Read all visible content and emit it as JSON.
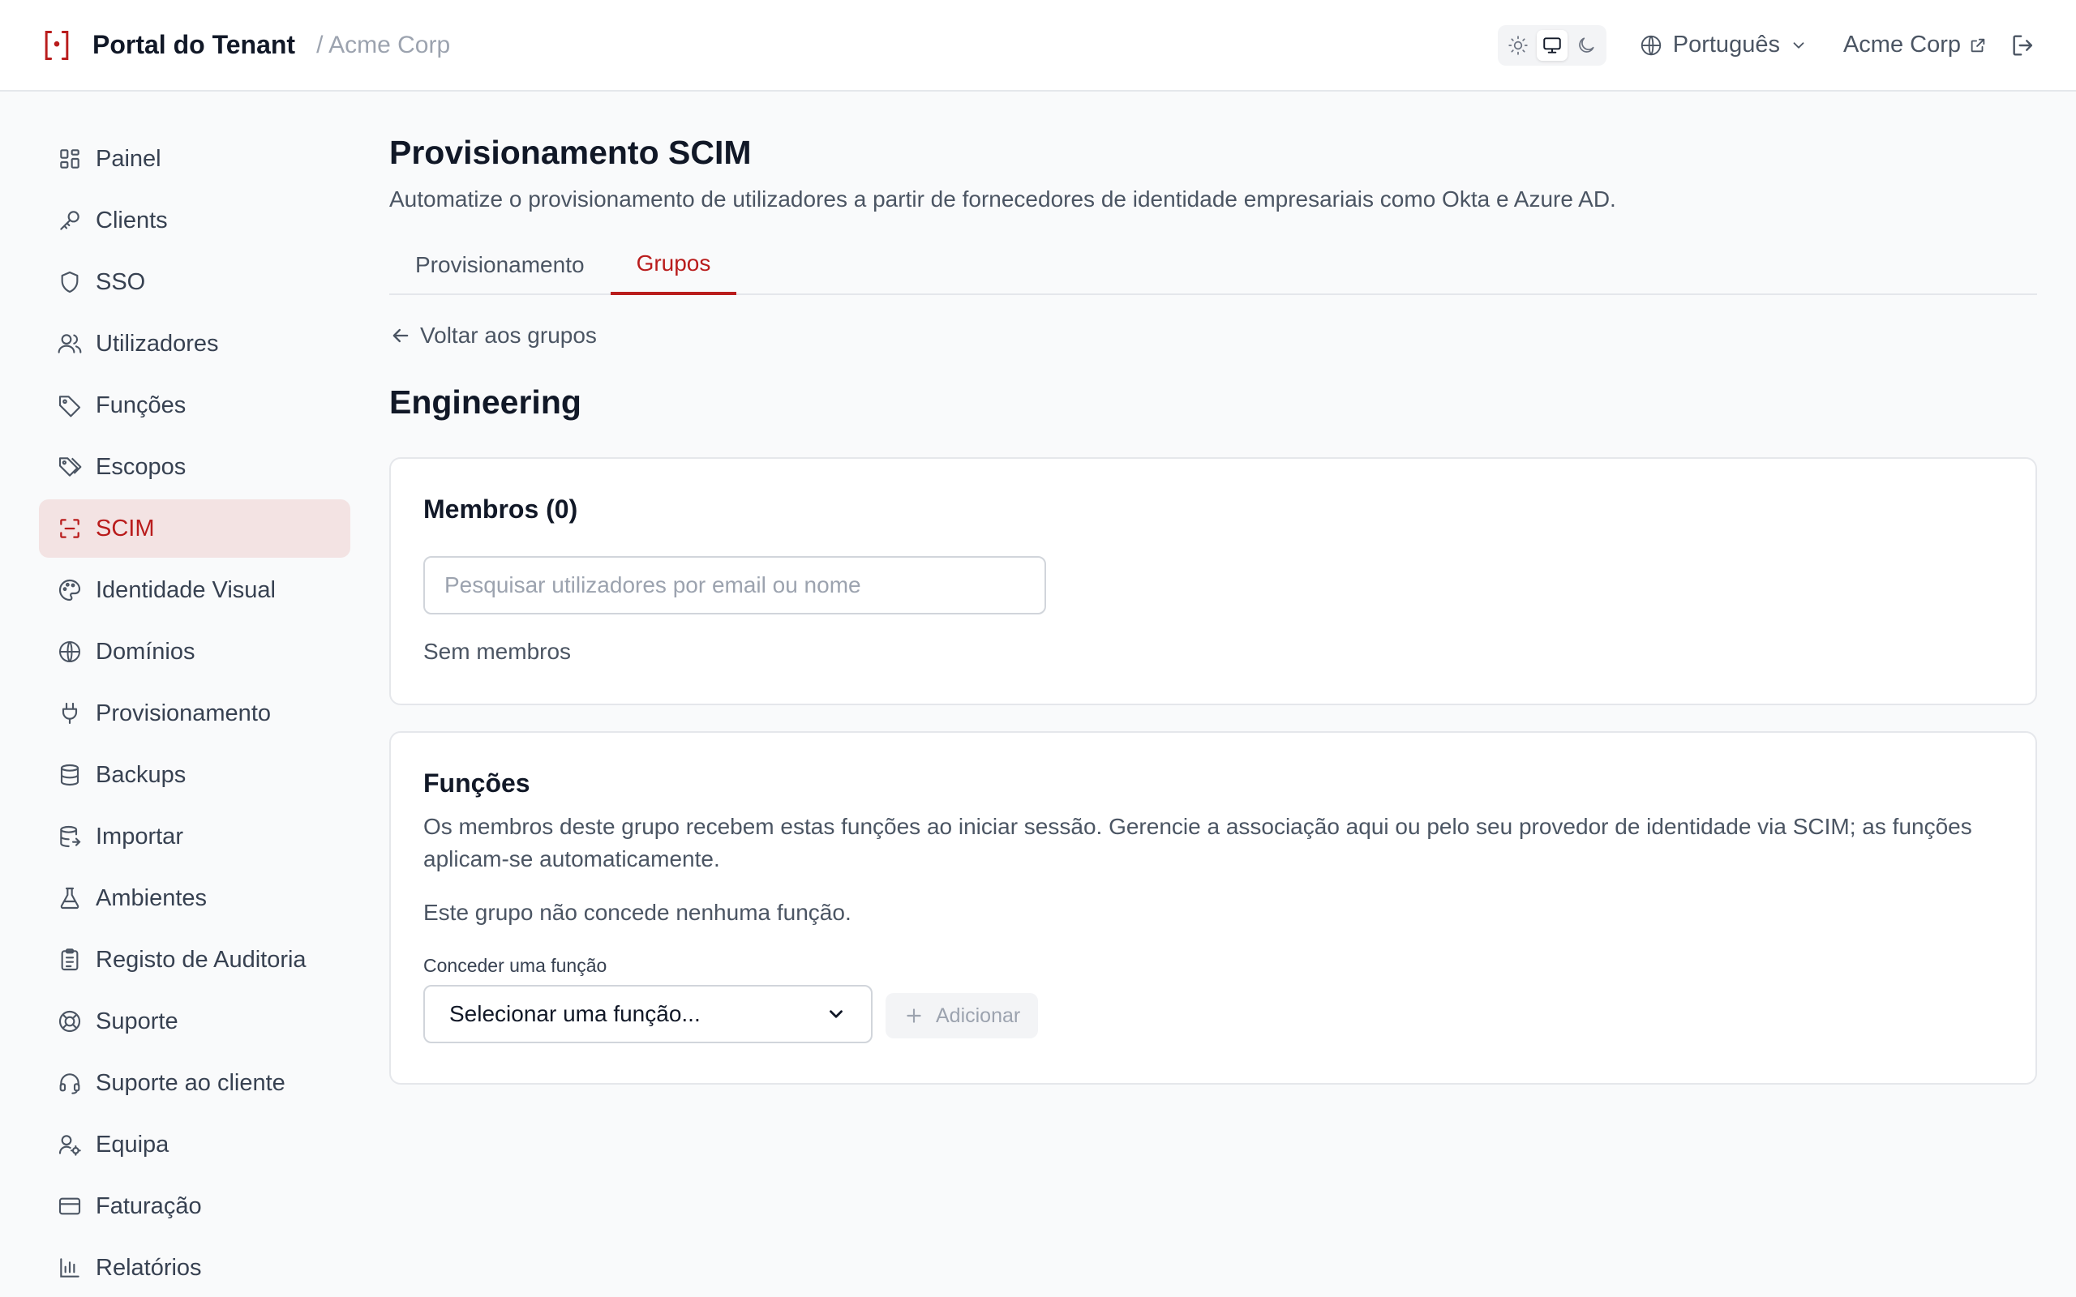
{
  "header": {
    "brand_name": "Portal do Tenant",
    "tenant_breadcrumb": "/ Acme Corp",
    "theme_options": [
      "light",
      "system",
      "dark"
    ],
    "theme_selected": "system",
    "language": "Português",
    "tenant_link": "Acme Corp"
  },
  "sidebar": {
    "items": [
      {
        "label": "Painel",
        "icon": "dashboard-icon"
      },
      {
        "label": "Clients",
        "icon": "key-icon"
      },
      {
        "label": "SSO",
        "icon": "shield-icon"
      },
      {
        "label": "Utilizadores",
        "icon": "users-icon"
      },
      {
        "label": "Funções",
        "icon": "tag-icon"
      },
      {
        "label": "Escopos",
        "icon": "tags-icon"
      },
      {
        "label": "SCIM",
        "icon": "scan-icon",
        "active": true
      },
      {
        "label": "Identidade Visual",
        "icon": "palette-icon"
      },
      {
        "label": "Domínios",
        "icon": "globe-icon"
      },
      {
        "label": "Provisionamento",
        "icon": "plug-icon"
      },
      {
        "label": "Backups",
        "icon": "database-icon"
      },
      {
        "label": "Importar",
        "icon": "database-import-icon"
      },
      {
        "label": "Ambientes",
        "icon": "flask-icon"
      },
      {
        "label": "Registo de Auditoria",
        "icon": "clipboard-icon"
      },
      {
        "label": "Suporte",
        "icon": "lifebuoy-icon"
      },
      {
        "label": "Suporte ao cliente",
        "icon": "headset-icon"
      },
      {
        "label": "Equipa",
        "icon": "user-cog-icon"
      },
      {
        "label": "Faturação",
        "icon": "credit-card-icon"
      },
      {
        "label": "Relatórios",
        "icon": "bar-chart-icon"
      }
    ]
  },
  "main": {
    "title": "Provisionamento SCIM",
    "subtitle": "Automatize o provisionamento de utilizadores a partir de fornecedores de identidade empresariais como Okta e Azure AD.",
    "tabs": [
      {
        "label": "Provisionamento"
      },
      {
        "label": "Grupos",
        "active": true
      }
    ],
    "back_link": "Voltar aos grupos",
    "group_name": "Engineering",
    "members": {
      "title": "Membros (0)",
      "search_placeholder": "Pesquisar utilizadores por email ou nome",
      "search_value": "",
      "empty_text": "Sem membros"
    },
    "roles": {
      "title": "Funções",
      "description": "Os membros deste grupo recebem estas funções ao iniciar sessão. Gerencie a associação aqui ou pelo seu provedor de identidade via SCIM; as funções aplicam-se automaticamente.",
      "empty_text": "Este grupo não concede nenhuma função.",
      "grant_label": "Conceder uma função",
      "select_value": "Selecionar uma função...",
      "add_button": "Adicionar"
    }
  },
  "colors": {
    "accent": "#b91c1c",
    "active_bg": "#f3e3e3",
    "page_bg": "#f9fafb"
  }
}
